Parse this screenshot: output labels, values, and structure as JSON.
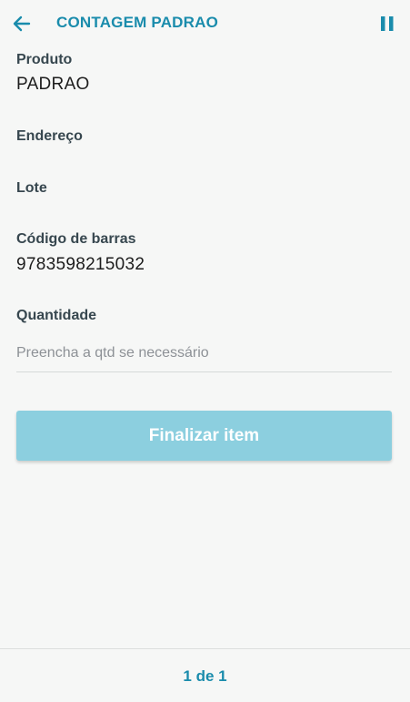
{
  "header": {
    "title": "CONTAGEM PADRAO",
    "back_icon": "arrow-left-icon",
    "pause_icon": "pause-icon",
    "accent_color": "#1a8cac"
  },
  "fields": {
    "produto": {
      "label": "Produto",
      "value": "PADRAO"
    },
    "endereco": {
      "label": "Endereço",
      "value": ""
    },
    "lote": {
      "label": "Lote",
      "value": ""
    },
    "codigo_barras": {
      "label": "Código de barras",
      "value": "9783598215032"
    },
    "quantidade": {
      "label": "Quantidade",
      "value": "",
      "placeholder": "Preencha a qtd se necessário"
    }
  },
  "actions": {
    "finish_label": "Finalizar item",
    "finish_color": "#8ccfdf"
  },
  "footer": {
    "pager": "1 de 1"
  }
}
